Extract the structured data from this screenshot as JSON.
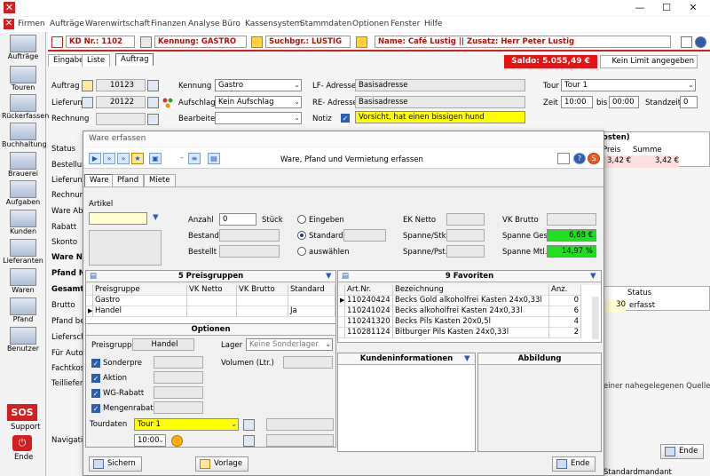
{
  "menu": [
    "Firmen",
    "Aufträge",
    "Warenwirtschaft",
    "Finanzen",
    "Analyse",
    "Büro",
    "Kassensystem",
    "Stammdaten",
    "Optionen",
    "Fenster",
    "Hilfe"
  ],
  "sidebar": [
    "Aufträge",
    "Touren",
    "Rückerfassen",
    "Buchhaltung",
    "Brauerei",
    "Aufgaben",
    "Kunden",
    "Lieferanten",
    "Waren",
    "Pfand",
    "Benutzer"
  ],
  "sos": {
    "icon": "SOS",
    "support": "Support",
    "ende": "Ende"
  },
  "kd": {
    "nr": "KD Nr.: 1102",
    "kennung": "Kennung: GASTRO",
    "suchbgr": "Suchbgr.: LUSTIG",
    "name": "Name: Café Lustig || Zusatz: Herr Peter Lustig"
  },
  "tabs": {
    "eingabe": "Eingabe",
    "liste": "Liste",
    "auftrag": "Auftrag"
  },
  "saldo": "Saldo: 5.055,49 €",
  "limit": "Kein Limit angegeben",
  "form": {
    "auftrag_lbl": "Auftrag",
    "auftrag_val": "10123",
    "lieferung_lbl": "Lieferung",
    "lieferung_val": "20122",
    "rechnung_lbl": "Rechnung",
    "kennung_lbl": "Kennung",
    "kennung_val": "Gastro",
    "aufschlag_lbl": "Aufschlag",
    "aufschlag_val": "Kein Aufschlag",
    "bearbeiter_lbl": "Bearbeiter",
    "lf_lbl": "LF- Adresse",
    "lf_val": "Basisadresse",
    "re_lbl": "RE- Adresse",
    "re_val": "Basisadresse",
    "notiz_lbl": "Notiz",
    "notiz_val": "Vorsicht, hat einen bissigen hund",
    "tour_lbl": "Tour",
    "tour_val": "Tour 1",
    "zeit_lbl": "Zeit",
    "zeit_von": "10:00",
    "bis_lbl": "bis",
    "zeit_bis": "00:00",
    "standzeit_lbl": "Standzeit",
    "standzeit_val": "0"
  },
  "left_labels": [
    "Status",
    "Bestellung",
    "Lieferung",
    "Rechnung",
    "Ware Abso",
    "Rabatt",
    "Skonto",
    "Ware Ne",
    "Pfand Ne",
    "Gesamt",
    "Brutto",
    "Pfand ber",
    "Lieferschei",
    "Für Autodr",
    "Fachtkost",
    "Teillieferun",
    "Navigation"
  ],
  "right_table": {
    "hdr": "osten)",
    "cols": [
      "Preis",
      "Summe"
    ],
    "row": [
      "3,42 €",
      "3,42 €"
    ]
  },
  "right_table2": {
    "cols": [
      "Status"
    ],
    "row": [
      "30",
      "erfasst"
    ]
  },
  "right_text": "einer nahegelegenen Quelle",
  "right_ende": "Ende",
  "status_right": "Standardmandant",
  "dialog": {
    "title": "Ware erfassen",
    "center": "Ware, Pfand und Vermietung erfassen",
    "tabs": [
      "Ware",
      "Pfand",
      "Miete"
    ],
    "artikel_lbl": "Artikel",
    "anzahl_lbl": "Anzahl",
    "anzahl_val": "0",
    "stueck": "Stück",
    "bestand_lbl": "Bestand",
    "bestellt_lbl": "Bestellt",
    "r_eingeben": "Eingeben",
    "r_standard": "Standard",
    "r_auswaehlen": "auswählen",
    "ek_lbl": "EK Netto",
    "spst_lbl": "Spanne/Stk.",
    "sppst_lbl": "Spanne/Pst.",
    "vk_lbl": "VK Brutto",
    "spges_lbl": "Spanne Ges.",
    "spges_val": "6,68 €",
    "spmtl_lbl": "Spanne Mtl.",
    "spmtl_val": "14,97 %",
    "preisgruppen_title": "5 Preisgruppen",
    "pg_cols": [
      "Preisgruppe",
      "VK Netto",
      "VK Brutto",
      "Standard"
    ],
    "pg_rows": [
      [
        "Gastro",
        "",
        "",
        ""
      ],
      [
        "Handel",
        "",
        "",
        "Ja"
      ]
    ],
    "fav_title": "9 Favoriten",
    "fav_cols": [
      "Art.Nr.",
      "Bezeichnung",
      "Anz."
    ],
    "fav_rows": [
      [
        "110240424",
        "Becks Gold alkoholfrei Kasten 24x0,33l",
        "0"
      ],
      [
        "110241024",
        "Becks alkoholfrei Kasten 24x0,33l",
        "6"
      ],
      [
        "110241320",
        "Becks Pils Kasten 20x0,5l",
        "4"
      ],
      [
        "110281124",
        "Bitburger Pils Kasten 24x0,33l",
        "2"
      ]
    ],
    "optionen_title": "Optionen",
    "preisgruppe_lbl": "Preisgruppe",
    "preisgruppe_val": "Handel",
    "lager_lbl": "Lager",
    "lager_val": "Keine Sonderlager",
    "volumen_lbl": "Volumen (Ltr.)",
    "chk": [
      "Sonderpre",
      "Aktion",
      "WG-Rabatt",
      "Mengenrabatt"
    ],
    "tourdaten_lbl": "Tourdaten",
    "tourdaten_val": "Tour 1",
    "tour_time": "10:00",
    "kunden_title": "Kundeninformationen",
    "abbildung_title": "Abbildung",
    "sichern": "Sichern",
    "vorlage": "Vorlage",
    "ende": "Ende"
  }
}
